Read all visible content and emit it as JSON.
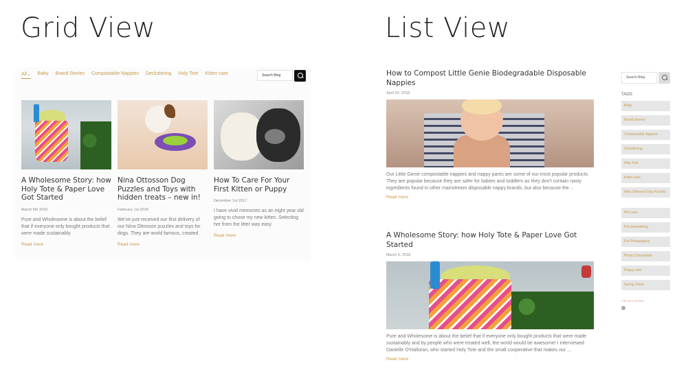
{
  "headings": {
    "grid": "Grid View",
    "list": "List View"
  },
  "grid": {
    "nav": [
      "All",
      "Baby",
      "Brand Stories",
      "Compostable Nappies",
      "Decluttering",
      "Holy Tote",
      "Kitten care"
    ],
    "nav_active_suffix": "⌄",
    "search_placeholder": "Search Blog",
    "cards": [
      {
        "title": "A Wholesome Story: how Holy Tote & Paper Love Got Started",
        "date": "March 5th 2018",
        "excerpt": "Pure and Wholesome is about the belief that if everyone only bought products that were made sustainably",
        "read_more": "Read more"
      },
      {
        "title": "Nina Ottosson Dog Puzzles and Toys with hidden treats – new in!",
        "date": "February 1st 2018",
        "excerpt": "We've just received our first delivery of our Nina Ottosson puzzles and toys for dogs.  They are world famous, created",
        "read_more": "Read more"
      },
      {
        "title": "How To Care For Your First Kitten or Puppy",
        "date": "December 1st 2017",
        "excerpt": "I have vivid memories as an eight year old going to chose my new kitten. Selecting her from the litter was easy",
        "read_more": "Read more"
      }
    ]
  },
  "list": {
    "posts": [
      {
        "title": "How to Compost Little Genie Biodegradable Disposable Nappies",
        "date": "April 20, 2018",
        "excerpt": "Our Little Genie compostable nappies and nappy pants are some of our most popular products.  They are popular because they are safer for babies and toddlers as they don't contain nasty ingredients found in other mainstream disposable nappy brands, but also because the…",
        "read_more": "Read more"
      },
      {
        "title": "A Wholesome Story: how Holy Tote & Paper Love Got Started",
        "date": "March 5, 2018",
        "excerpt": "Pure and Wholesome is about the belief that if everyone only bought products that were made sustainably and by people who were treated well, the world would be awesome!  I interviewed Danielle O'Halloran, who started Holy Tote and the small cooperative that makes our …",
        "read_more": "Read more"
      }
    ],
    "sidebar": {
      "search_placeholder": "Search Blog",
      "tags_title": "TAGS",
      "tags": [
        "Baby",
        "Brand Stories",
        "Compostable Nappies",
        "Decluttering",
        "Holy Tote",
        "Kitten care",
        "Nina Ottosson Dog Puzzles",
        "Pet Love",
        "Pet deshedding",
        "Pet Photography",
        "Photo Competition",
        "Puppy care",
        "Spring Clean"
      ],
      "rss_label": "Full post archive"
    }
  },
  "colors": {
    "accent": "#c89a4e",
    "tag_bg": "#e6e6e6"
  }
}
